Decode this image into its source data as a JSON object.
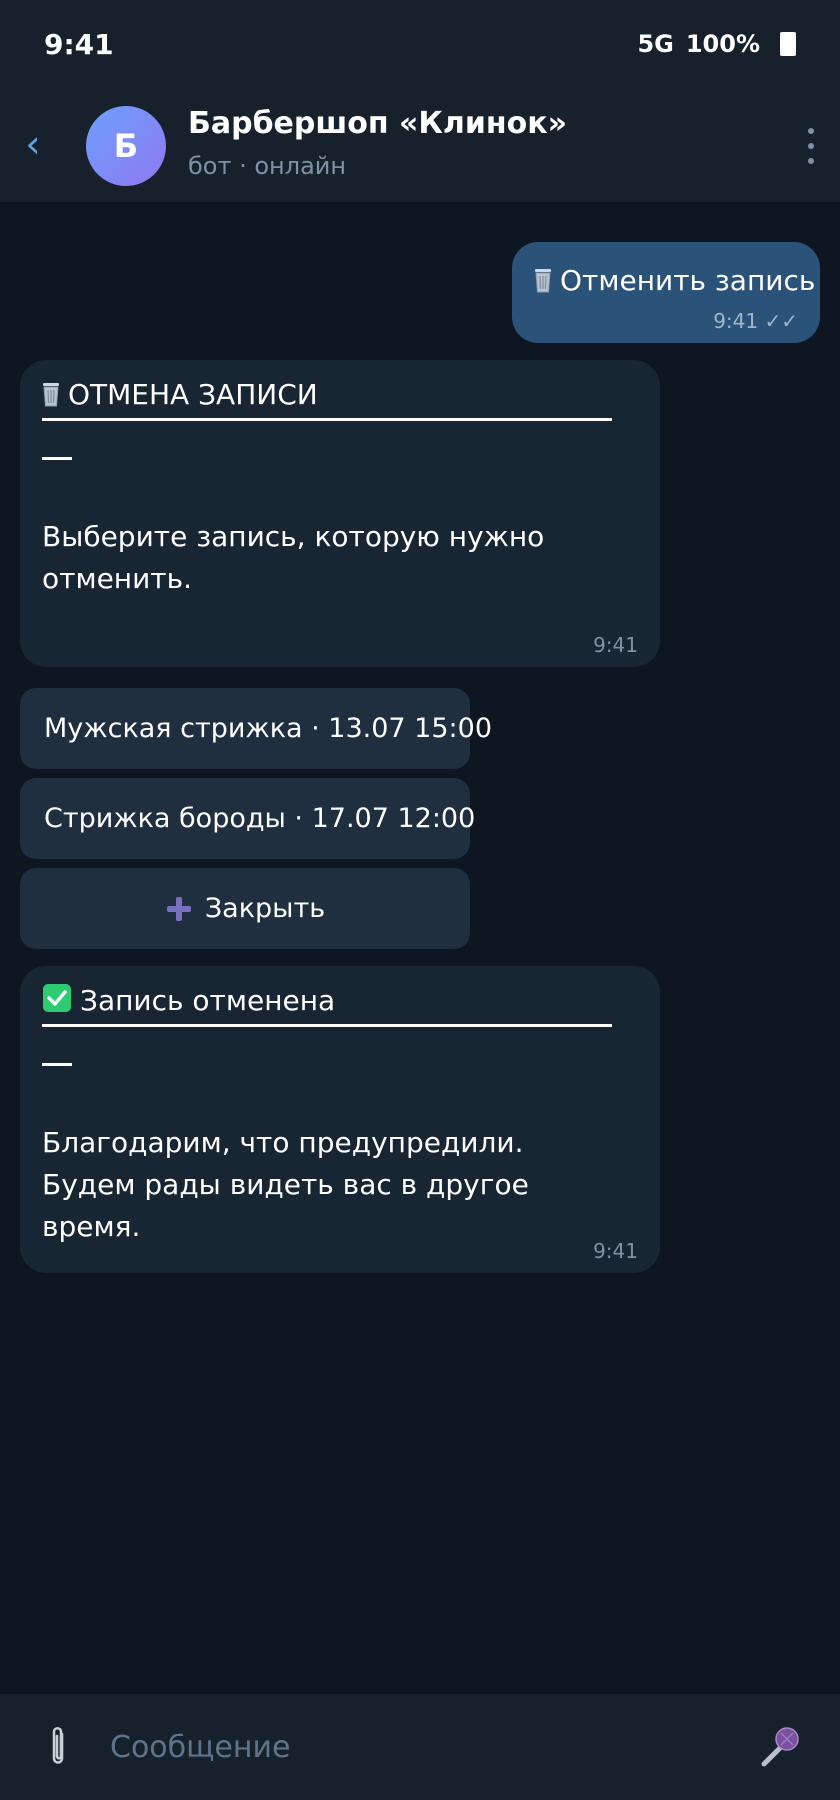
{
  "status_bar": {
    "time": "9:41",
    "network": "5G",
    "battery": "100%"
  },
  "header": {
    "avatar_letter": "Б",
    "title": "Барбершоп «Клинок»",
    "subtitle": "бот · онлайн"
  },
  "messages": {
    "outgoing": {
      "text": "Отменить запись",
      "time": "9:41",
      "status": "✓✓"
    },
    "cancel_prompt": {
      "title": "ОТМЕНА ЗАПИСИ",
      "body": "Выберите запись, которую нужно отменить.",
      "time": "9:41"
    },
    "cancelled": {
      "title": "Запись отменена",
      "body": "Благодарим, что предупредили. Будем рады видеть вас в другое время.",
      "time": "9:41"
    }
  },
  "keyboard": {
    "buttons": [
      {
        "label": "Мужская стрижка · 13.07 15:00"
      },
      {
        "label": "Стрижка бороды · 17.07 12:00"
      },
      {
        "label": "Закрыть"
      }
    ]
  },
  "composer": {
    "placeholder": "Сообщение"
  },
  "colors": {
    "background": "#0e1621",
    "header": "#17212b",
    "outgoing_bubble": "#2b5278",
    "incoming_bubble": "#182533",
    "keyboard_button": "#1f2f40",
    "accent": "#5ea4e0",
    "check_green": "#2ecc71"
  },
  "icons": {
    "back": "chevron-left-icon",
    "more": "more-vertical-icon",
    "trash": "wastebasket-icon",
    "check": "check-box-icon",
    "plus": "plus-icon",
    "attach": "paperclip-icon",
    "mic": "microphone-icon"
  }
}
